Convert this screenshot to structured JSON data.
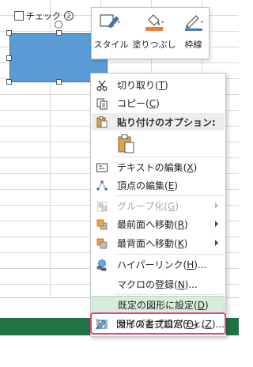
{
  "checkbox": {
    "label": "チェック",
    "number": "2"
  },
  "mini_toolbar": {
    "style_label": "スタイル",
    "fill_label": "塗りつぶし",
    "outline_label": "枠線"
  },
  "context_menu": {
    "cut": "切り取り(",
    "cut_key": "T",
    "copy": "コピー(",
    "copy_key": "C",
    "paste_options": "貼り付けのオプション:",
    "edit_text": "テキストの編集(",
    "edit_text_key": "X",
    "edit_points": "頂点の編集(",
    "edit_points_key": "E",
    "group": "グループ化(",
    "group_key": "G",
    "bring_front": "最前面へ移動(",
    "bring_front_key": "R",
    "send_back": "最背面へ移動(",
    "send_back_key": "K",
    "hyperlink": "ハイパーリンク(",
    "hyperlink_key": "H",
    "hyperlink_tail": ")...",
    "assign_macro": "マクロの登録(",
    "assign_macro_key": "N",
    "assign_macro_tail": ")...",
    "set_default": "既定の図形に設定(",
    "set_default_key": "D",
    "size_props": "サイズとプロパティ(",
    "size_props_key": "Z",
    "size_props_tail": ")...",
    "format_shape": "図形の書式設定(",
    "format_shape_key": "O",
    "format_shape_tail": ")...",
    "close_paren": ")"
  },
  "colors": {
    "shape_fill": "#5b9bd5",
    "status_bar": "#217346",
    "highlight": "#d7ecdd",
    "callout_outline": "#e5457a"
  },
  "icons": [
    "scissors-icon",
    "copy-icon",
    "paste-icon",
    "edit-text-icon",
    "edit-points-icon",
    "group-icon",
    "bring-front-icon",
    "send-back-icon",
    "hyperlink-icon",
    "size-properties-icon",
    "format-shape-icon",
    "style-icon",
    "fill-bucket-icon",
    "outline-pen-icon"
  ]
}
